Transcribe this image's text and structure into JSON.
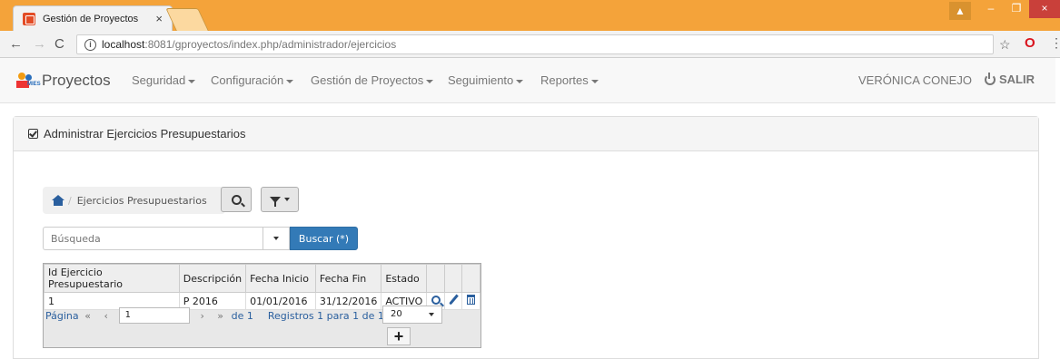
{
  "browser": {
    "tab_title": "Gestión de Proyectos",
    "url_host": "localhost",
    "url_path": ":8081/gproyectos/index.php/administrador/ejercicios"
  },
  "navbar": {
    "brand": "Proyectos",
    "brand_logo_text": "MIES",
    "items": [
      {
        "label": "Seguridad"
      },
      {
        "label": "Configuración"
      },
      {
        "label": "Gestión de Proyectos"
      },
      {
        "label": "Seguimiento"
      },
      {
        "label": "Reportes"
      }
    ],
    "user": "VERÓNICA CONEJO",
    "logout": "SALIR"
  },
  "panel": {
    "title": "Administrar Ejercicios Presupuestarios",
    "breadcrumb": "Ejercicios Presupuestarios"
  },
  "search": {
    "placeholder": "Búsqueda",
    "button": "Buscar (*)"
  },
  "grid": {
    "columns": [
      "Id Ejercicio Presupuestario",
      "Descripción",
      "Fecha Inicio",
      "Fecha Fin",
      "Estado"
    ],
    "rows": [
      [
        "1",
        "P 2016",
        "01/01/2016",
        "31/12/2016",
        "ACTIVO"
      ]
    ],
    "pager": {
      "page_label": "Página",
      "page_value": "1",
      "of_label": "de 1",
      "records_label": "Registros 1 para 1 de 1",
      "page_size": "20"
    }
  }
}
